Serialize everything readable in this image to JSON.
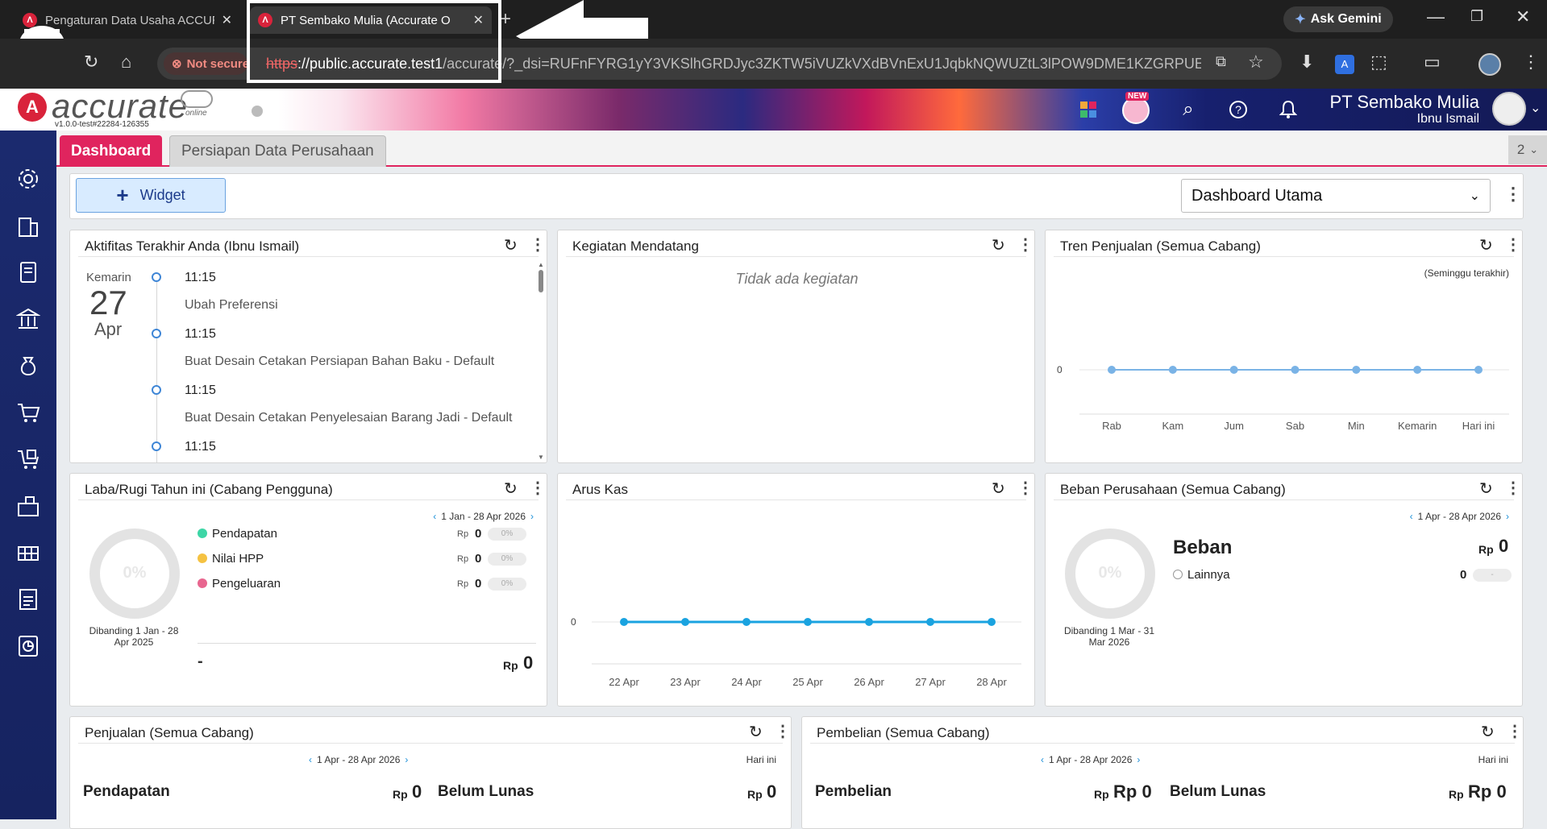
{
  "browser": {
    "tab1_title": "Pengaturan Data Usaha ACCUR",
    "tab2_title": "PT Sembako Mulia (Accurate O",
    "new_tab": "+",
    "ask_gemini": "Ask Gemini",
    "not_secure": "Not secure",
    "url_scheme": "https",
    "url_host": "://public.accurate.test1",
    "url_rest": "/accurate/?_dsi=RUFnFYRG1yY3VKSlhGRDJyc3ZKTW5iVUZkVXdBVnExU1JqbkNQWUZtL3lPOW9DME1KZGRPUEhzdUhK..."
  },
  "app": {
    "logo_letter": "A",
    "logo_text": "accurate",
    "logo_sub": "online",
    "version": "v1.0.0-test#22284-126355",
    "new_badge": "NEW",
    "company": "PT Sembako Mulia",
    "user": "Ibnu Ismail"
  },
  "tabs": {
    "dashboard": "Dashboard",
    "persiapan": "Persiapan Data Perusahaan",
    "count": "2"
  },
  "toolbar": {
    "widget_button": "Widget",
    "dashboard_select": "Dashboard Utama"
  },
  "activity": {
    "title": "Aktifitas Terakhir Anda (Ibnu Ismail)",
    "day_label": "Kemarin",
    "day_num": "27",
    "month": "Apr",
    "items": [
      {
        "time": "11:15",
        "text": "Ubah Preferensi"
      },
      {
        "time": "11:15",
        "text": "Buat Desain Cetakan Persiapan Bahan Baku - Default"
      },
      {
        "time": "11:15",
        "text": "Buat Desain Cetakan Penyelesaian Barang Jadi - Default"
      },
      {
        "time": "11:15",
        "text": ""
      }
    ]
  },
  "upcoming": {
    "title": "Kegiatan Mendatang",
    "empty": "Tidak ada kegiatan"
  },
  "sales_trend": {
    "title": "Tren Penjualan (Semua Cabang)",
    "subtitle": "(Seminggu terakhir)",
    "y_tick": "0"
  },
  "profit_loss": {
    "title": "Laba/Rugi Tahun ini (Cabang Pengguna)",
    "range": "1 Jan - 28 Apr 2026",
    "donut": "0%",
    "compare": "Dibanding 1 Jan - 28 Apr 2025",
    "rows": [
      {
        "label": "Pendapatan",
        "cur": "Rp",
        "val": "0",
        "pct": "0%",
        "color": "#3dd6a6"
      },
      {
        "label": "Nilai HPP",
        "cur": "Rp",
        "val": "0",
        "pct": "0%",
        "color": "#f5c242"
      },
      {
        "label": "Pengeluaran",
        "cur": "Rp",
        "val": "0",
        "pct": "0%",
        "color": "#e8668f"
      }
    ],
    "total_dash": "-",
    "total_cur": "Rp",
    "total_val": "0"
  },
  "cashflow": {
    "title": "Arus Kas",
    "y_tick": "0"
  },
  "expense": {
    "title": "Beban Perusahaan (Semua Cabang)",
    "range": "1 Apr - 28 Apr 2026",
    "donut": "0%",
    "compare": "Dibanding 1 Mar - 31 Mar 2026",
    "heading": "Beban",
    "heading_cur": "Rp",
    "heading_val": "0",
    "other_label": "Lainnya",
    "other_val": "0",
    "other_pct": "-"
  },
  "sales": {
    "title": "Penjualan (Semua Cabang)",
    "range": "1 Apr - 28 Apr 2026",
    "today": "Hari ini",
    "income_label": "Pendapatan",
    "income_cur": "Rp",
    "income_val": "0",
    "unpaid_label": "Belum Lunas",
    "unpaid_cur": "Rp",
    "unpaid_val": "0"
  },
  "purchases": {
    "title": "Pembelian (Semua Cabang)",
    "range": "1 Apr - 28 Apr 2026",
    "today": "Hari ini",
    "buy_label": "Pembelian",
    "buy_cur": "Rp",
    "buy_val": "Rp 0",
    "unpaid_label": "Belum Lunas",
    "unpaid_cur": "Rp",
    "unpaid_val": "Rp 0"
  },
  "chart_data": [
    {
      "type": "line",
      "categories": [
        "Rab",
        "Kam",
        "Jum",
        "Sab",
        "Min",
        "Kemarin",
        "Hari ini"
      ],
      "values": [
        0,
        0,
        0,
        0,
        0,
        0,
        0
      ],
      "yticks": [
        "0"
      ],
      "color": "#7ab3e6"
    },
    {
      "type": "line",
      "categories": [
        "22 Apr",
        "23 Apr",
        "24 Apr",
        "25 Apr",
        "26 Apr",
        "27 Apr",
        "28 Apr"
      ],
      "values": [
        0,
        0,
        0,
        0,
        0,
        0,
        0
      ],
      "yticks": [
        "0"
      ],
      "color": "#1aa3e0"
    }
  ],
  "colors": {
    "accent": "#e0245e",
    "sidebar": "#1b2a6e"
  }
}
